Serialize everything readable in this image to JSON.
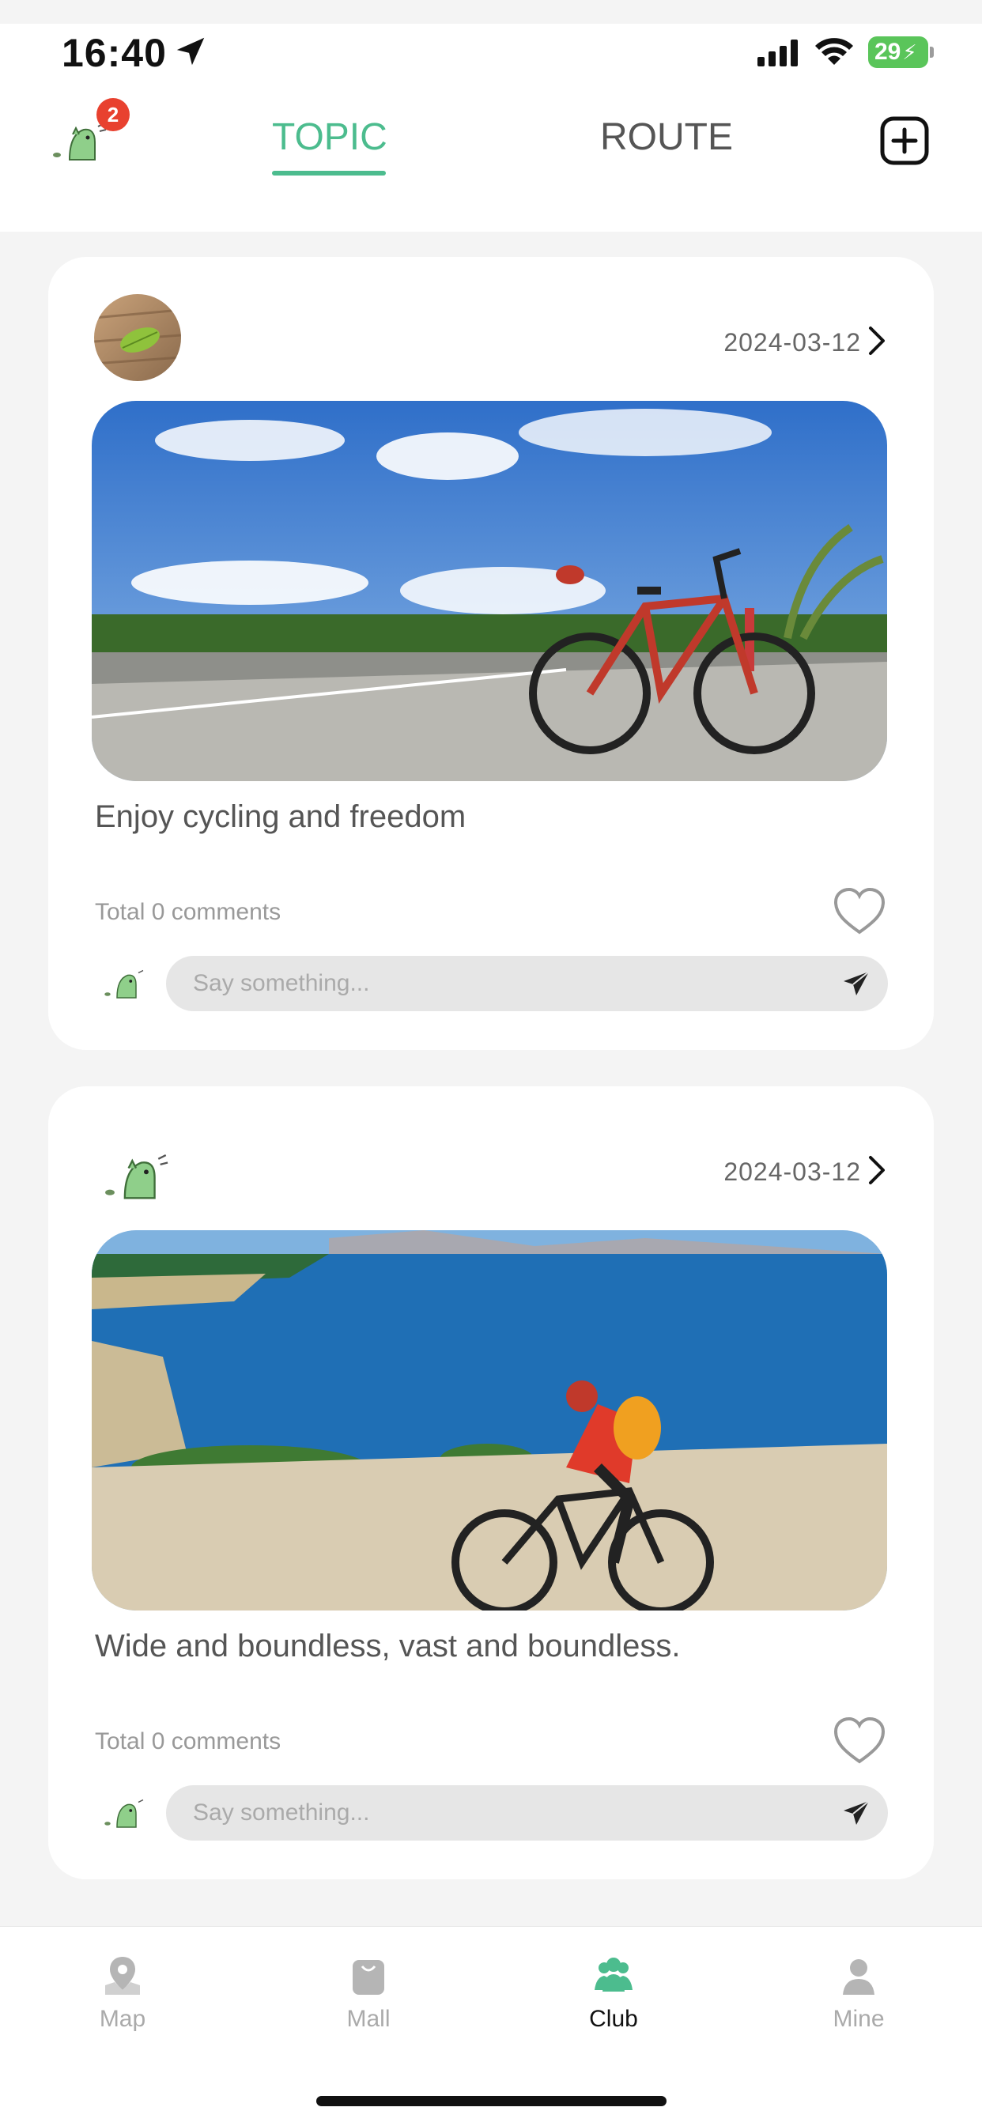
{
  "status_bar": {
    "time": "16:40",
    "battery": "29",
    "icons": [
      "location-arrow-icon",
      "cellular-signal-icon",
      "wifi-icon",
      "battery-charging-icon"
    ]
  },
  "header": {
    "tabs": [
      {
        "label": "TOPIC",
        "active": true
      },
      {
        "label": "ROUTE",
        "active": false
      }
    ],
    "notification_count": "2",
    "accent_color": "#4cbc8e",
    "badge_color": "#e8412f",
    "icons": [
      "dino-avatar-icon",
      "add-square-icon"
    ]
  },
  "posts": [
    {
      "date": "2024-03-12",
      "caption": "Enjoy cycling and freedom",
      "comments_label": "Total 0 comments",
      "comment_placeholder": "Say something...",
      "liked": false
    },
    {
      "date": "2024-03-12",
      "caption": "Wide and boundless, vast and boundless.",
      "comments_label": "Total 0 comments",
      "comment_placeholder": "Say something...",
      "liked": false
    }
  ],
  "bottom_nav": {
    "items": [
      {
        "label": "Map",
        "icon": "map-pin-icon",
        "active": false
      },
      {
        "label": "Mall",
        "icon": "shopping-bag-icon",
        "active": false
      },
      {
        "label": "Club",
        "icon": "group-icon",
        "active": true
      },
      {
        "label": "Mine",
        "icon": "person-icon",
        "active": false
      }
    ]
  }
}
